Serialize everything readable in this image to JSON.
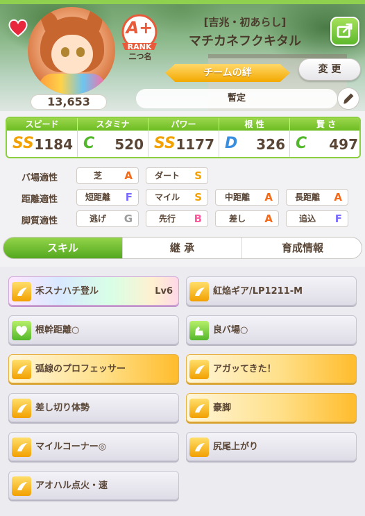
{
  "header": {
    "score": "13,653",
    "rank": "A+",
    "rank_label": "RANK",
    "alias": "二つ名",
    "title": "[吉兆・初あらし]",
    "name": "マチカネフクキタル",
    "team_label": "チームの絆",
    "change_label": "変 更",
    "tentative_label": "暫定"
  },
  "stats": [
    {
      "label": "スピード",
      "grade": "SS",
      "value": "1184",
      "color": "#f2a100"
    },
    {
      "label": "スタミナ",
      "grade": "C",
      "value": "520",
      "color": "#52b72a"
    },
    {
      "label": "パワー",
      "grade": "SS",
      "value": "1177",
      "color": "#f2a100"
    },
    {
      "label": "根 性",
      "grade": "D",
      "value": "326",
      "color": "#3a8ee0"
    },
    {
      "label": "賢 さ",
      "grade": "C",
      "value": "497",
      "color": "#52b72a"
    }
  ],
  "aptitude": {
    "track_label": "バ場適性",
    "distance_label": "距離適性",
    "style_label": "脚質適性",
    "track": [
      {
        "label": "芝",
        "grade": "A"
      },
      {
        "label": "ダート",
        "grade": "S"
      }
    ],
    "distance": [
      {
        "label": "短距離",
        "grade": "F"
      },
      {
        "label": "マイル",
        "grade": "S"
      },
      {
        "label": "中距離",
        "grade": "A"
      },
      {
        "label": "長距離",
        "grade": "A"
      }
    ],
    "style": [
      {
        "label": "逃げ",
        "grade": "G"
      },
      {
        "label": "先行",
        "grade": "B"
      },
      {
        "label": "差し",
        "grade": "A"
      },
      {
        "label": "追込",
        "grade": "F"
      }
    ],
    "grade_colors": {
      "S": "#f2a100",
      "A": "#f26a1a",
      "B": "#ff5ba0",
      "F": "#7a6cff",
      "G": "#9c9c9c"
    }
  },
  "tabs": [
    "スキル",
    "継 承",
    "育成情報"
  ],
  "skills": [
    {
      "name": "禾スナハチ登ル",
      "level": "Lv6",
      "style": "rainbow",
      "icon": "speed"
    },
    {
      "name": "紅焔ギア/LP1211-M",
      "level": "",
      "style": "normal",
      "icon": "speed"
    },
    {
      "name": "根幹距離○",
      "level": "",
      "style": "normal",
      "icon": "stamina"
    },
    {
      "name": "良バ場○",
      "level": "",
      "style": "normal",
      "icon": "power"
    },
    {
      "name": "弧線のプロフェッサー",
      "level": "",
      "style": "gold",
      "icon": "speed"
    },
    {
      "name": "アガッてきた！",
      "level": "",
      "style": "gold",
      "icon": "speed"
    },
    {
      "name": "差し切り体勢",
      "level": "",
      "style": "normal",
      "icon": "speed"
    },
    {
      "name": "豪脚",
      "level": "",
      "style": "gold",
      "icon": "speed"
    },
    {
      "name": "マイルコーナー◎",
      "level": "",
      "style": "normal",
      "icon": "speed"
    },
    {
      "name": "尻尾上がり",
      "level": "",
      "style": "normal",
      "icon": "speed"
    },
    {
      "name": "アオハル点火・速",
      "level": "",
      "style": "normal",
      "icon": "speed"
    }
  ]
}
